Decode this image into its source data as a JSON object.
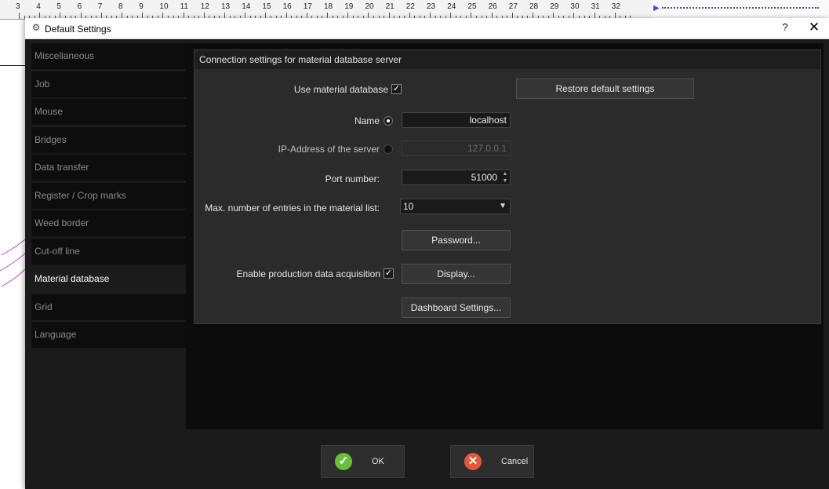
{
  "ruler": {
    "numbers": [
      "3",
      "4",
      "5",
      "6",
      "7",
      "8",
      "9",
      "10",
      "11",
      "12",
      "13",
      "14",
      "15",
      "16",
      "17",
      "18",
      "19",
      "20",
      "21",
      "22",
      "23",
      "24",
      "25",
      "26",
      "27",
      "28",
      "29",
      "30",
      "31",
      "32"
    ]
  },
  "dialog": {
    "title": "Default Settings",
    "help": "?",
    "close": "✕"
  },
  "sidebar": {
    "items": [
      {
        "label": "Miscellaneous"
      },
      {
        "label": "Job"
      },
      {
        "label": "Mouse"
      },
      {
        "label": "Bridges"
      },
      {
        "label": "Data transfer"
      },
      {
        "label": "Register / Crop marks"
      },
      {
        "label": "Weed border"
      },
      {
        "label": "Cut-off line"
      },
      {
        "label": "Material database"
      },
      {
        "label": "Grid"
      },
      {
        "label": "Language"
      }
    ],
    "active_index": 8
  },
  "panel": {
    "header": "Connection settings for material database server",
    "use_db_label": "Use material database",
    "use_db_checked": true,
    "restore_button": "Restore default settings",
    "name_label": "Name",
    "name_value": "localhost",
    "ip_label": "IP-Address of the server",
    "ip_value": "127.0.0.1",
    "port_label": "Port number:",
    "port_value": "51000",
    "max_entries_label": "Max. number of entries in the material list:",
    "max_entries_value": "10",
    "password_button": "Password...",
    "production_label": "Enable production data acquisition",
    "production_checked": true,
    "display_button": "Display...",
    "dashboard_button": "Dashboard Settings..."
  },
  "footer": {
    "ok_label": "OK",
    "cancel_label": "Cancel"
  },
  "colors": {
    "dialog_bg": "#1b1b1b",
    "ok_icon": "#6cbf3a",
    "cancel_icon": "#e05a3a"
  }
}
